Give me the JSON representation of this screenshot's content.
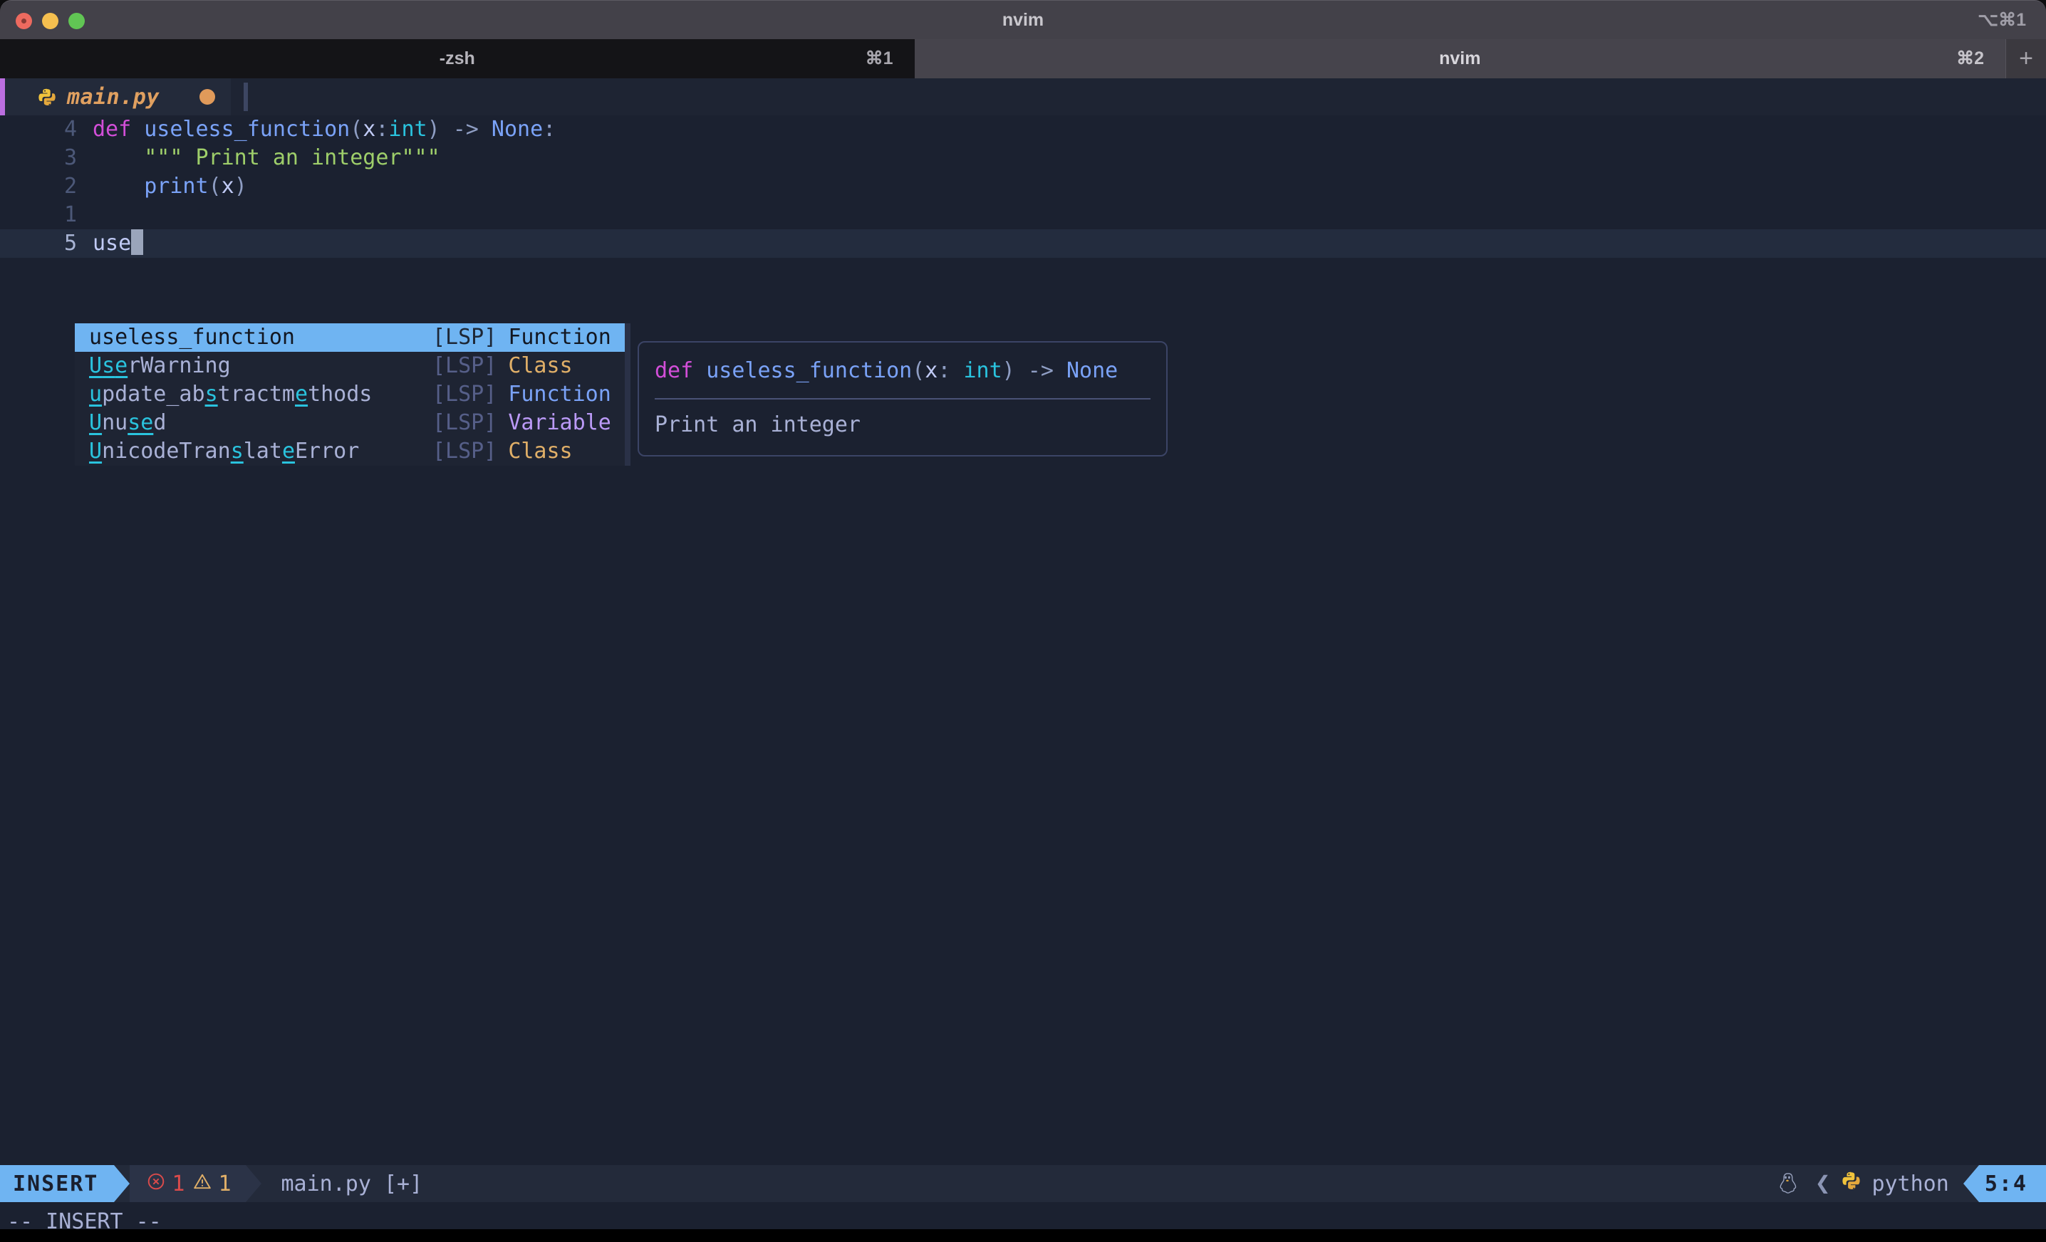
{
  "window": {
    "title": "nvim",
    "title_shortcut": "⌥⌘1",
    "traffic_lights": [
      "close-button",
      "minimize-button",
      "zoom-button"
    ]
  },
  "tabbar": {
    "tabs": [
      {
        "label": "-zsh",
        "shortcut": "⌘1",
        "active": false
      },
      {
        "label": "nvim",
        "shortcut": "⌘2",
        "active": true
      }
    ],
    "new_tab_label": "+"
  },
  "bufferline": {
    "icon": "python-icon",
    "name": "main.py",
    "modified_indicator": "modified-dot"
  },
  "editor": {
    "lines": [
      {
        "num": "4",
        "current": false,
        "tokens": [
          {
            "t": "def ",
            "c": "kw"
          },
          {
            "t": "useless_function",
            "c": "fn"
          },
          {
            "t": "(",
            "c": "punct"
          },
          {
            "t": "x",
            "c": "plain"
          },
          {
            "t": ":",
            "c": "punct"
          },
          {
            "t": "int",
            "c": "type"
          },
          {
            "t": ")",
            "c": "punct"
          },
          {
            "t": " -> ",
            "c": "arrow"
          },
          {
            "t": "None",
            "c": "none"
          },
          {
            "t": ":",
            "c": "punct"
          }
        ]
      },
      {
        "num": "3",
        "current": false,
        "tokens": [
          {
            "t": "    \"\"\" Print an integer\"\"\"",
            "c": "str"
          }
        ]
      },
      {
        "num": "2",
        "current": false,
        "tokens": [
          {
            "t": "    ",
            "c": "plain"
          },
          {
            "t": "print",
            "c": "call"
          },
          {
            "t": "(",
            "c": "punct"
          },
          {
            "t": "x",
            "c": "plain"
          },
          {
            "t": ")",
            "c": "punct"
          }
        ]
      },
      {
        "num": "1",
        "current": false,
        "tokens": [
          {
            "t": "",
            "c": "plain"
          }
        ]
      },
      {
        "num": "5",
        "current": true,
        "tokens": [
          {
            "t": "use",
            "c": "plain"
          }
        ]
      }
    ]
  },
  "completion": {
    "items": [
      {
        "selected": true,
        "source": "[LSP]",
        "kind": "Function",
        "label_parts": [
          {
            "t": "useless_function",
            "m": false
          }
        ]
      },
      {
        "selected": false,
        "source": "[LSP]",
        "kind": "Class",
        "label_parts": [
          {
            "t": "U",
            "m": true
          },
          {
            "t": "s",
            "m": true
          },
          {
            "t": "e",
            "m": true
          },
          {
            "t": "rWarning",
            "m": false
          }
        ]
      },
      {
        "selected": false,
        "source": "[LSP]",
        "kind": "Function",
        "label_parts": [
          {
            "t": "u",
            "m": true
          },
          {
            "t": "pdate_ab",
            "m": false
          },
          {
            "t": "s",
            "m": true
          },
          {
            "t": "tractm",
            "m": false
          },
          {
            "t": "e",
            "m": true
          },
          {
            "t": "thods",
            "m": false
          }
        ]
      },
      {
        "selected": false,
        "source": "[LSP]",
        "kind": "Variable",
        "label_parts": [
          {
            "t": "U",
            "m": true
          },
          {
            "t": "nu",
            "m": false
          },
          {
            "t": "se",
            "m": true
          },
          {
            "t": "d",
            "m": false
          }
        ]
      },
      {
        "selected": false,
        "source": "[LSP]",
        "kind": "Class",
        "label_parts": [
          {
            "t": "U",
            "m": true
          },
          {
            "t": "nicodeTran",
            "m": false
          },
          {
            "t": "s",
            "m": true
          },
          {
            "t": "lat",
            "m": false
          },
          {
            "t": "e",
            "m": true
          },
          {
            "t": "Error",
            "m": false
          }
        ]
      }
    ]
  },
  "documentation": {
    "signature_tokens": [
      {
        "t": "def ",
        "c": "kw"
      },
      {
        "t": "useless_function",
        "c": "fn"
      },
      {
        "t": "(",
        "c": "punct"
      },
      {
        "t": "x",
        "c": "plain"
      },
      {
        "t": ": ",
        "c": "punct"
      },
      {
        "t": "int",
        "c": "type"
      },
      {
        "t": ")",
        "c": "punct"
      },
      {
        "t": " -> ",
        "c": "arrow"
      },
      {
        "t": "None",
        "c": "none"
      }
    ],
    "body": "Print an integer"
  },
  "statusline": {
    "mode": "INSERT",
    "error_icon": "error-circle-icon",
    "error_count": "1",
    "warning_icon": "warning-triangle-icon",
    "warning_count": "1",
    "filename": "main.py [+]",
    "os_icon": "linux-penguin-icon",
    "separator_icon": "chevron-left-icon",
    "lang_icon": "python-icon",
    "lang": "python",
    "position": "5:4"
  },
  "message": {
    "text": "-- INSERT --"
  },
  "colors": {
    "accent_blue": "#6fb4f2",
    "editor_bg": "#1b2130",
    "bufferline_bg": "#1e2433",
    "statusline_bg": "#232a3a",
    "error": "#db4b4b",
    "warning": "#e0af68",
    "string": "#9ece6a",
    "keyword": "#d24ed8",
    "function": "#7aa2f7",
    "type": "#2ac3de",
    "variable_kind": "#bb9af7",
    "match_highlight": "#2ac3de",
    "modified_dot": "#e09a5a",
    "buffer_name": "#e0a060",
    "buffer_edge": "#bb6ee0"
  }
}
